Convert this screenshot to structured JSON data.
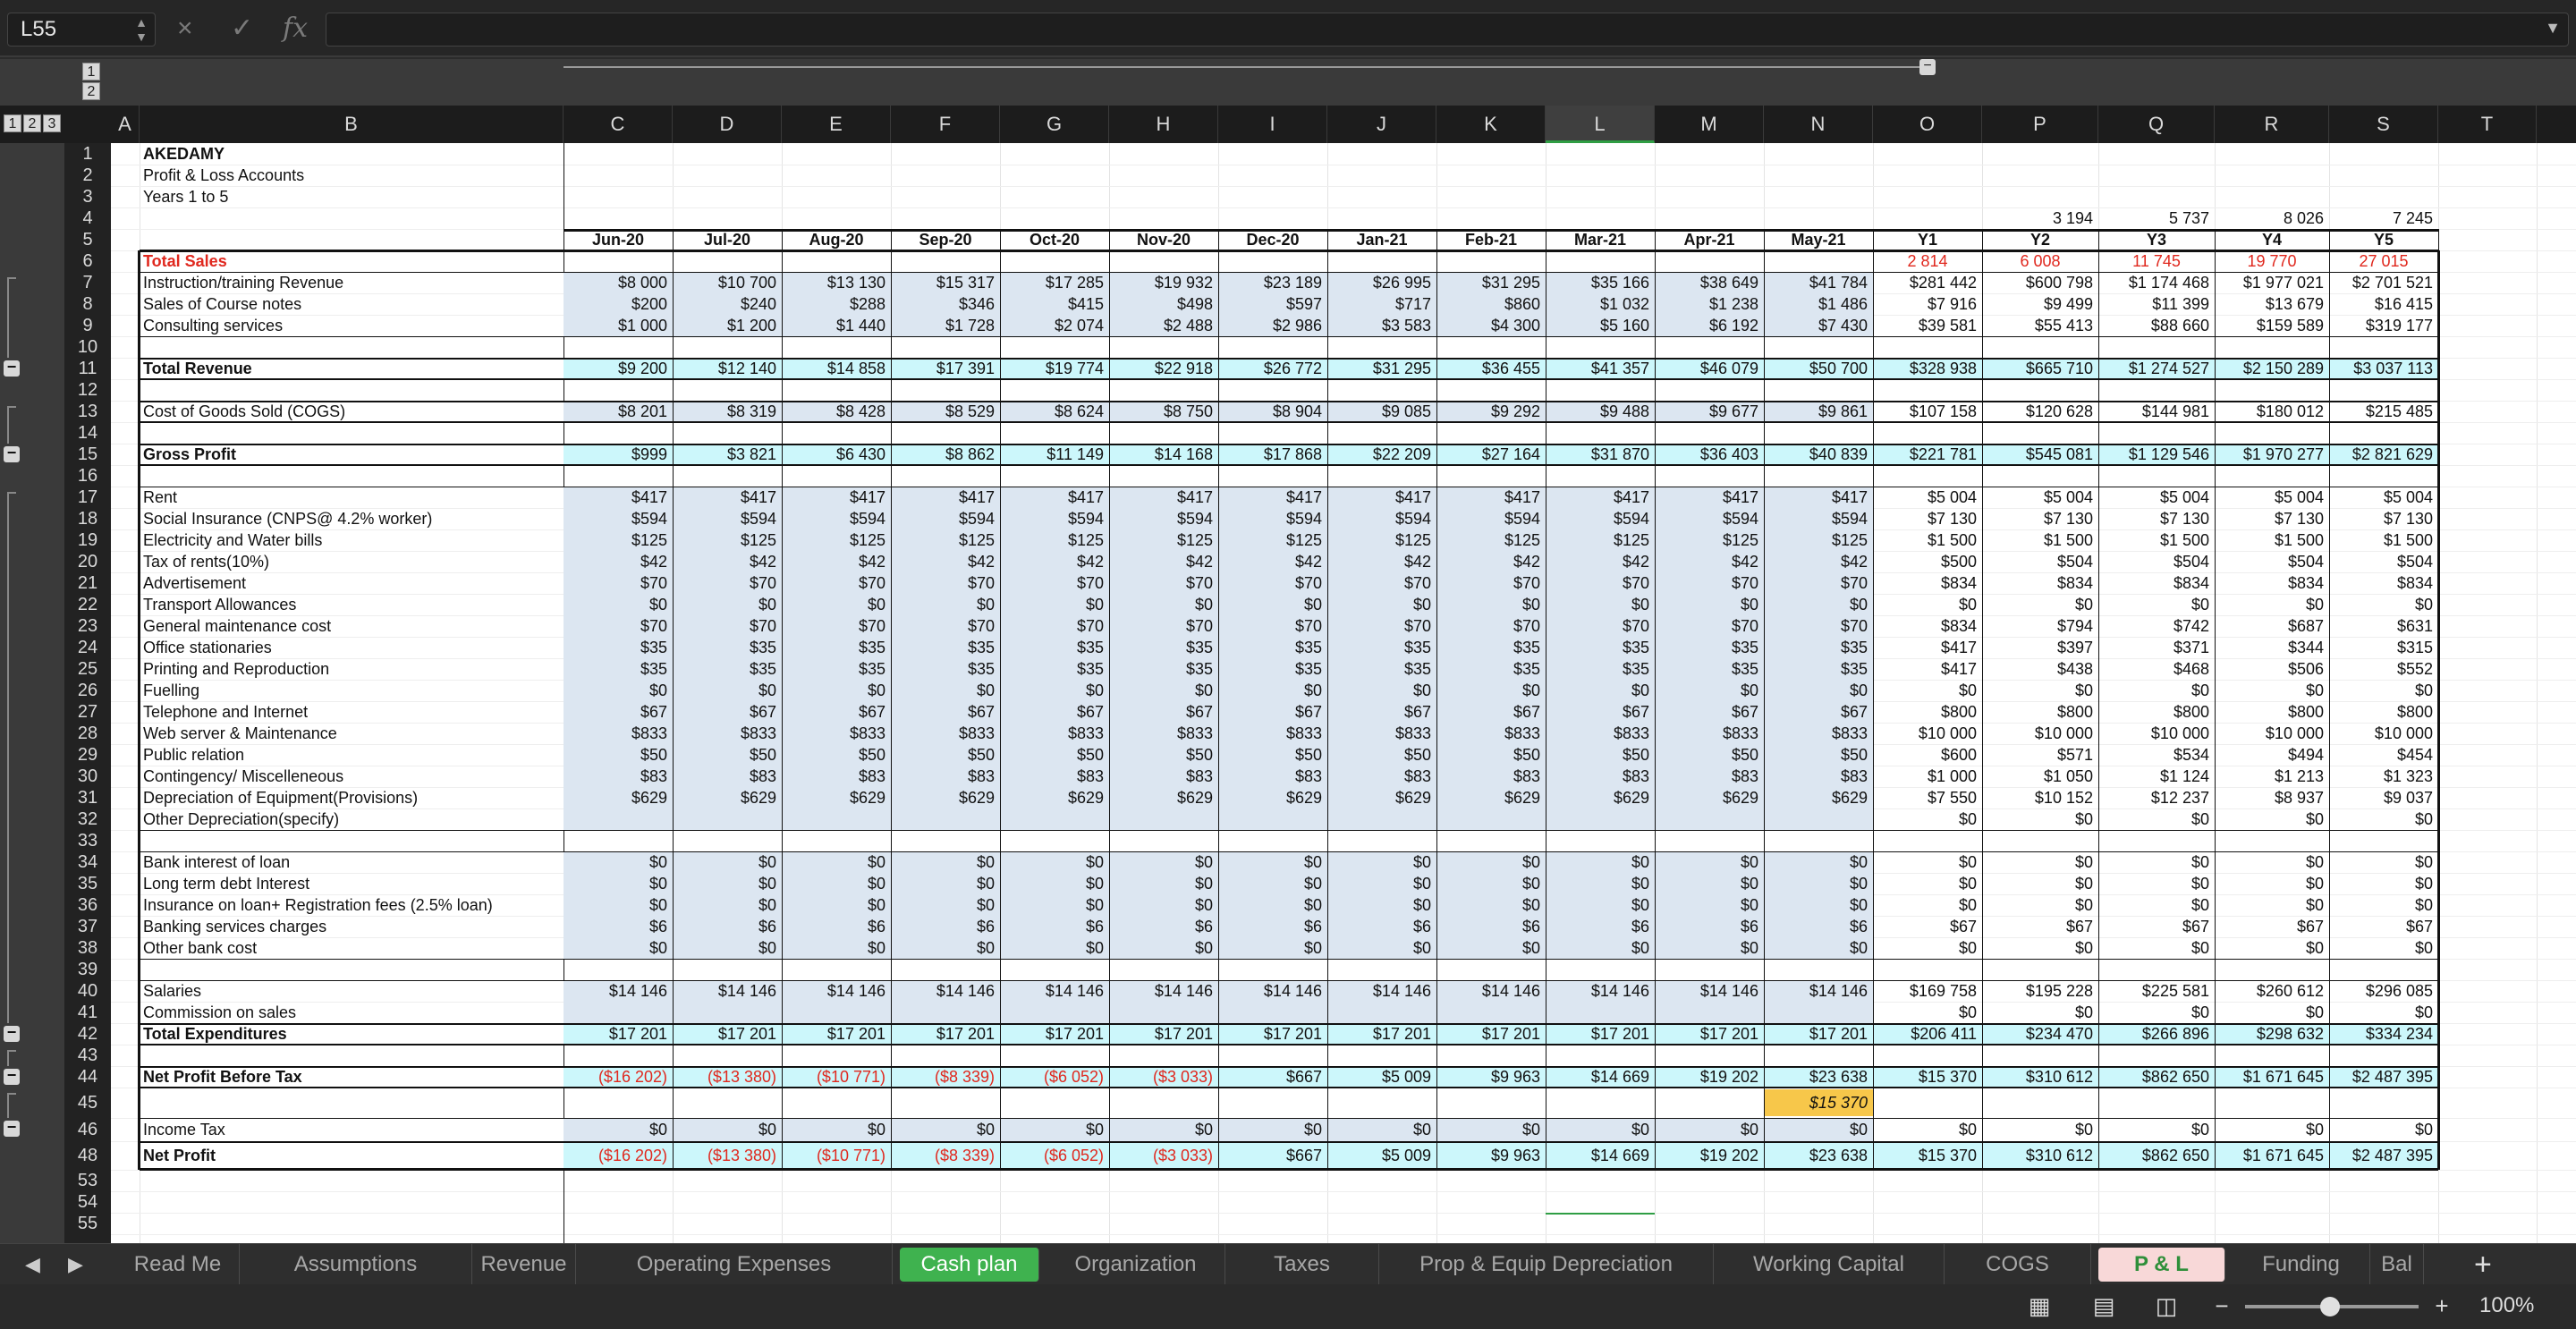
{
  "formula_bar": {
    "name_box": "L55",
    "cancel_icon": "×",
    "confirm_icon": "✓",
    "fx_label": "fx",
    "formula": ""
  },
  "outline_levels": [
    "1",
    "2",
    "3"
  ],
  "top_outline_levels": [
    "1",
    "2"
  ],
  "columns": [
    "A",
    "B",
    "C",
    "D",
    "E",
    "F",
    "G",
    "H",
    "I",
    "J",
    "K",
    "L",
    "M",
    "N",
    "O",
    "P",
    "Q",
    "R",
    "S",
    "T"
  ],
  "selected_column": "L",
  "row_numbers": [
    "1",
    "2",
    "3",
    "4",
    "5",
    "6",
    "7",
    "8",
    "9",
    "10",
    "11",
    "12",
    "13",
    "14",
    "15",
    "16",
    "17",
    "18",
    "19",
    "20",
    "21",
    "22",
    "23",
    "24",
    "25",
    "26",
    "27",
    "28",
    "29",
    "30",
    "31",
    "32",
    "33",
    "34",
    "35",
    "36",
    "37",
    "38",
    "39",
    "40",
    "41",
    "42",
    "43",
    "44",
    "45",
    "46",
    "48",
    "53",
    "54",
    "55"
  ],
  "title": {
    "company": "AKEDAMY",
    "report": "Profit & Loss Accounts",
    "years": "Years 1 to 5"
  },
  "row4_values": [
    "3 194",
    "5 737",
    "8 026",
    "7 245"
  ],
  "periods": [
    "Jun-20",
    "Jul-20",
    "Aug-20",
    "Sep-20",
    "Oct-20",
    "Nov-20",
    "Dec-20",
    "Jan-21",
    "Feb-21",
    "Mar-21",
    "Apr-21",
    "May-21",
    "Y1",
    "Y2",
    "Y3",
    "Y4",
    "Y5"
  ],
  "total_sales": {
    "label": "Total Sales",
    "values": [
      "2 814",
      "6 008",
      "11 745",
      "19 770",
      "27 015"
    ]
  },
  "rows": [
    {
      "label": "Instruction/training Revenue",
      "values": [
        "$8 000",
        "$10 700",
        "$13 130",
        "$15 317",
        "$17 285",
        "$19 932",
        "$23 189",
        "$26 995",
        "$31 295",
        "$35 166",
        "$38 649",
        "$41 784",
        "$281 442",
        "$600 798",
        "$1 174 468",
        "$1 977 021",
        "$2 701 521"
      ]
    },
    {
      "label": "Sales of Course notes",
      "values": [
        "$200",
        "$240",
        "$288",
        "$346",
        "$415",
        "$498",
        "$597",
        "$717",
        "$860",
        "$1 032",
        "$1 238",
        "$1 486",
        "$7 916",
        "$9 499",
        "$11 399",
        "$13 679",
        "$16 415"
      ]
    },
    {
      "label": "Consulting services",
      "values": [
        "$1 000",
        "$1 200",
        "$1 440",
        "$1 728",
        "$2 074",
        "$2 488",
        "$2 986",
        "$3 583",
        "$4 300",
        "$5 160",
        "$6 192",
        "$7 430",
        "$39 581",
        "$55 413",
        "$88 660",
        "$159 589",
        "$319 177"
      ]
    },
    {
      "label": "",
      "values": []
    },
    {
      "label": "Total Revenue",
      "bold": true,
      "values": [
        "$9 200",
        "$12 140",
        "$14 858",
        "$17 391",
        "$19 774",
        "$22 918",
        "$26 772",
        "$31 295",
        "$36 455",
        "$41 357",
        "$46 079",
        "$50 700",
        "$328 938",
        "$665 710",
        "$1 274 527",
        "$2 150 289",
        "$3 037 113"
      ]
    },
    {
      "label": "",
      "values": []
    },
    {
      "label": "Cost of Goods Sold (COGS)",
      "values": [
        "$8 201",
        "$8 319",
        "$8 428",
        "$8 529",
        "$8 624",
        "$8 750",
        "$8 904",
        "$9 085",
        "$9 292",
        "$9 488",
        "$9 677",
        "$9 861",
        "$107 158",
        "$120 628",
        "$144 981",
        "$180 012",
        "$215 485"
      ]
    },
    {
      "label": "",
      "values": []
    },
    {
      "label": "Gross Profit",
      "bold": true,
      "values": [
        "$999",
        "$3 821",
        "$6 430",
        "$8 862",
        "$11 149",
        "$14 168",
        "$17 868",
        "$22 209",
        "$27 164",
        "$31 870",
        "$36 403",
        "$40 839",
        "$221 781",
        "$545 081",
        "$1 129 546",
        "$1 970 277",
        "$2 821 629"
      ]
    },
    {
      "label": "",
      "values": []
    },
    {
      "label": "Rent",
      "values": [
        "$417",
        "$417",
        "$417",
        "$417",
        "$417",
        "$417",
        "$417",
        "$417",
        "$417",
        "$417",
        "$417",
        "$417",
        "$5 004",
        "$5 004",
        "$5 004",
        "$5 004",
        "$5 004"
      ]
    },
    {
      "label": "Social Insurance (CNPS@ 4.2% worker)",
      "values": [
        "$594",
        "$594",
        "$594",
        "$594",
        "$594",
        "$594",
        "$594",
        "$594",
        "$594",
        "$594",
        "$594",
        "$594",
        "$7 130",
        "$7 130",
        "$7 130",
        "$7 130",
        "$7 130"
      ]
    },
    {
      "label": "Electricity and Water bills",
      "values": [
        "$125",
        "$125",
        "$125",
        "$125",
        "$125",
        "$125",
        "$125",
        "$125",
        "$125",
        "$125",
        "$125",
        "$125",
        "$1 500",
        "$1 500",
        "$1 500",
        "$1 500",
        "$1 500"
      ]
    },
    {
      "label": "Tax of rents(10%)",
      "values": [
        "$42",
        "$42",
        "$42",
        "$42",
        "$42",
        "$42",
        "$42",
        "$42",
        "$42",
        "$42",
        "$42",
        "$42",
        "$500",
        "$504",
        "$504",
        "$504",
        "$504"
      ]
    },
    {
      "label": "Advertisement",
      "values": [
        "$70",
        "$70",
        "$70",
        "$70",
        "$70",
        "$70",
        "$70",
        "$70",
        "$70",
        "$70",
        "$70",
        "$70",
        "$834",
        "$834",
        "$834",
        "$834",
        "$834"
      ]
    },
    {
      "label": "Transport Allowances",
      "values": [
        "$0",
        "$0",
        "$0",
        "$0",
        "$0",
        "$0",
        "$0",
        "$0",
        "$0",
        "$0",
        "$0",
        "$0",
        "$0",
        "$0",
        "$0",
        "$0",
        "$0"
      ]
    },
    {
      "label": "General maintenance cost",
      "values": [
        "$70",
        "$70",
        "$70",
        "$70",
        "$70",
        "$70",
        "$70",
        "$70",
        "$70",
        "$70",
        "$70",
        "$70",
        "$834",
        "$794",
        "$742",
        "$687",
        "$631"
      ]
    },
    {
      "label": "Office stationaries",
      "values": [
        "$35",
        "$35",
        "$35",
        "$35",
        "$35",
        "$35",
        "$35",
        "$35",
        "$35",
        "$35",
        "$35",
        "$35",
        "$417",
        "$397",
        "$371",
        "$344",
        "$315"
      ]
    },
    {
      "label": "Printing and Reproduction",
      "values": [
        "$35",
        "$35",
        "$35",
        "$35",
        "$35",
        "$35",
        "$35",
        "$35",
        "$35",
        "$35",
        "$35",
        "$35",
        "$417",
        "$438",
        "$468",
        "$506",
        "$552"
      ]
    },
    {
      "label": "Fuelling",
      "values": [
        "$0",
        "$0",
        "$0",
        "$0",
        "$0",
        "$0",
        "$0",
        "$0",
        "$0",
        "$0",
        "$0",
        "$0",
        "$0",
        "$0",
        "$0",
        "$0",
        "$0"
      ]
    },
    {
      "label": "Telephone and Internet",
      "values": [
        "$67",
        "$67",
        "$67",
        "$67",
        "$67",
        "$67",
        "$67",
        "$67",
        "$67",
        "$67",
        "$67",
        "$67",
        "$800",
        "$800",
        "$800",
        "$800",
        "$800"
      ]
    },
    {
      "label": "Web server & Maintenance",
      "values": [
        "$833",
        "$833",
        "$833",
        "$833",
        "$833",
        "$833",
        "$833",
        "$833",
        "$833",
        "$833",
        "$833",
        "$833",
        "$10 000",
        "$10 000",
        "$10 000",
        "$10 000",
        "$10 000"
      ]
    },
    {
      "label": "Public relation",
      "values": [
        "$50",
        "$50",
        "$50",
        "$50",
        "$50",
        "$50",
        "$50",
        "$50",
        "$50",
        "$50",
        "$50",
        "$50",
        "$600",
        "$571",
        "$534",
        "$494",
        "$454"
      ]
    },
    {
      "label": "Contingency/ Miscelleneous",
      "values": [
        "$83",
        "$83",
        "$83",
        "$83",
        "$83",
        "$83",
        "$83",
        "$83",
        "$83",
        "$83",
        "$83",
        "$83",
        "$1 000",
        "$1 050",
        "$1 124",
        "$1 213",
        "$1 323"
      ]
    },
    {
      "label": "Depreciation of Equipment(Provisions)",
      "values": [
        "$629",
        "$629",
        "$629",
        "$629",
        "$629",
        "$629",
        "$629",
        "$629",
        "$629",
        "$629",
        "$629",
        "$629",
        "$7 550",
        "$10 152",
        "$12 237",
        "$8 937",
        "$9 037"
      ]
    },
    {
      "label": "Other Depreciation(specify)",
      "values": [
        "",
        "",
        "",
        "",
        "",
        "",
        "",
        "",
        "",
        "",
        "",
        "",
        "$0",
        "$0",
        "$0",
        "$0",
        "$0"
      ]
    },
    {
      "label": "",
      "values": []
    },
    {
      "label": "Bank interest of loan",
      "values": [
        "$0",
        "$0",
        "$0",
        "$0",
        "$0",
        "$0",
        "$0",
        "$0",
        "$0",
        "$0",
        "$0",
        "$0",
        "$0",
        "$0",
        "$0",
        "$0",
        "$0"
      ]
    },
    {
      "label": "Long term debt Interest",
      "values": [
        "$0",
        "$0",
        "$0",
        "$0",
        "$0",
        "$0",
        "$0",
        "$0",
        "$0",
        "$0",
        "$0",
        "$0",
        "$0",
        "$0",
        "$0",
        "$0",
        "$0"
      ]
    },
    {
      "label": "Insurance on loan+ Registration fees (2.5% loan)",
      "values": [
        "$0",
        "$0",
        "$0",
        "$0",
        "$0",
        "$0",
        "$0",
        "$0",
        "$0",
        "$0",
        "$0",
        "$0",
        "$0",
        "$0",
        "$0",
        "$0",
        "$0"
      ]
    },
    {
      "label": "Banking services charges",
      "values": [
        "$6",
        "$6",
        "$6",
        "$6",
        "$6",
        "$6",
        "$6",
        "$6",
        "$6",
        "$6",
        "$6",
        "$6",
        "$67",
        "$67",
        "$67",
        "$67",
        "$67"
      ]
    },
    {
      "label": "Other bank cost",
      "values": [
        "$0",
        "$0",
        "$0",
        "$0",
        "$0",
        "$0",
        "$0",
        "$0",
        "$0",
        "$0",
        "$0",
        "$0",
        "$0",
        "$0",
        "$0",
        "$0",
        "$0"
      ]
    },
    {
      "label": "",
      "values": []
    },
    {
      "label": "Salaries",
      "values": [
        "$14 146",
        "$14 146",
        "$14 146",
        "$14 146",
        "$14 146",
        "$14 146",
        "$14 146",
        "$14 146",
        "$14 146",
        "$14 146",
        "$14 146",
        "$14 146",
        "$169 758",
        "$195 228",
        "$225 581",
        "$260 612",
        "$296 085"
      ]
    },
    {
      "label": "Commission on sales",
      "values": [
        "",
        "",
        "",
        "",
        "",
        "",
        "",
        "",
        "",
        "",
        "",
        "",
        "$0",
        "$0",
        "$0",
        "$0",
        "$0"
      ]
    },
    {
      "label": "Total  Expenditures",
      "bold": true,
      "values": [
        "$17 201",
        "$17 201",
        "$17 201",
        "$17 201",
        "$17 201",
        "$17 201",
        "$17 201",
        "$17 201",
        "$17 201",
        "$17 201",
        "$17 201",
        "$17 201",
        "$206 411",
        "$234 470",
        "$266 896",
        "$298 632",
        "$334 234"
      ]
    },
    {
      "label": "",
      "values": []
    },
    {
      "label": "Net Profit Before Tax",
      "bold": true,
      "values": [
        "($16 202)",
        "($13 380)",
        "($10 771)",
        "($8 339)",
        "($6 052)",
        "($3 033)",
        "$667",
        "$5 009",
        "$9 963",
        "$14 669",
        "$19 202",
        "$23 638",
        "$15 370",
        "$310 612",
        "$862 650",
        "$1 671 645",
        "$2 487 395"
      ]
    },
    {
      "label": "",
      "values": [
        "",
        "",
        "",
        "",
        "",
        "",
        "",
        "",
        "",
        "",
        "",
        "$15 370",
        "",
        "",
        "",
        "",
        ""
      ]
    },
    {
      "label": "Income Tax",
      "values": [
        "$0",
        "$0",
        "$0",
        "$0",
        "$0",
        "$0",
        "$0",
        "$0",
        "$0",
        "$0",
        "$0",
        "$0",
        "$0",
        "$0",
        "$0",
        "$0",
        "$0"
      ]
    },
    {
      "label": "Net Profit",
      "bold": true,
      "values": [
        "($16 202)",
        "($13 380)",
        "($10 771)",
        "($8 339)",
        "($6 052)",
        "($3 033)",
        "$667",
        "$5 009",
        "$9 963",
        "$14 669",
        "$19 202",
        "$23 638",
        "$15 370",
        "$310 612",
        "$862 650",
        "$1 671 645",
        "$2 487 395"
      ]
    }
  ],
  "sheet_tabs": [
    "Read Me",
    "Assumptions",
    "Revenue",
    "Operating Expenses",
    "Cash plan",
    "Organization",
    "Taxes",
    "Prop & Equip Depreciation",
    "Working Capital",
    "COGS",
    "P & L",
    "Funding",
    "Bal"
  ],
  "active_tab": "P & L",
  "add_sheet": "+",
  "zoom": "100%",
  "colors": {
    "negative": "#e0281e",
    "cash_plan_tab": "#3fb24f",
    "active_tab": "#f8d8d8",
    "input_fill": "#dce6f1",
    "total_fill": "#ccf7fb",
    "highlight": "#f7c74a"
  }
}
